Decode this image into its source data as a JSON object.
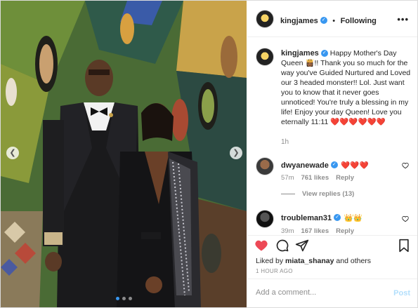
{
  "post": {
    "author": "kingjames",
    "follow_label": "Following",
    "more_icon": "more-horizontal-icon",
    "caption_author": "kingjames",
    "caption_text": "Happy Mother's Day Queen 👸🏾!! Thank you so much for the way you've Guided Nurtured and Loved our 3 headed monster!! Lol. Just want you to know that it never goes unnoticed! You're truly a blessing in my life! Enjoy your day Queen! Love you eternally 11:11 ❤️❤️❤️❤️❤️❤️",
    "caption_time": "1h"
  },
  "comments": [
    {
      "user": "dwyanewade",
      "text": "❤️❤️❤️",
      "time": "57m",
      "likes": "761 likes",
      "reply": "Reply",
      "view_replies": "View replies (13)"
    },
    {
      "user": "troubleman31",
      "text": "👑👑",
      "time": "39m",
      "likes": "167 likes",
      "reply": "Reply"
    }
  ],
  "actions": {
    "liked_by_prefix": "Liked by",
    "liked_by_user": "miata_shanay",
    "liked_by_suffix": "and others",
    "time_ago": "1 HOUR AGO"
  },
  "add_comment": {
    "placeholder": "Add a comment...",
    "post_label": "Post"
  },
  "colors": {
    "accent": "#3897f0",
    "like_red": "#ed4956",
    "muted": "#8e8e8e",
    "post_disabled": "#b2dffc"
  },
  "carousel": {
    "slide_count": 3,
    "active_slide": 1
  }
}
